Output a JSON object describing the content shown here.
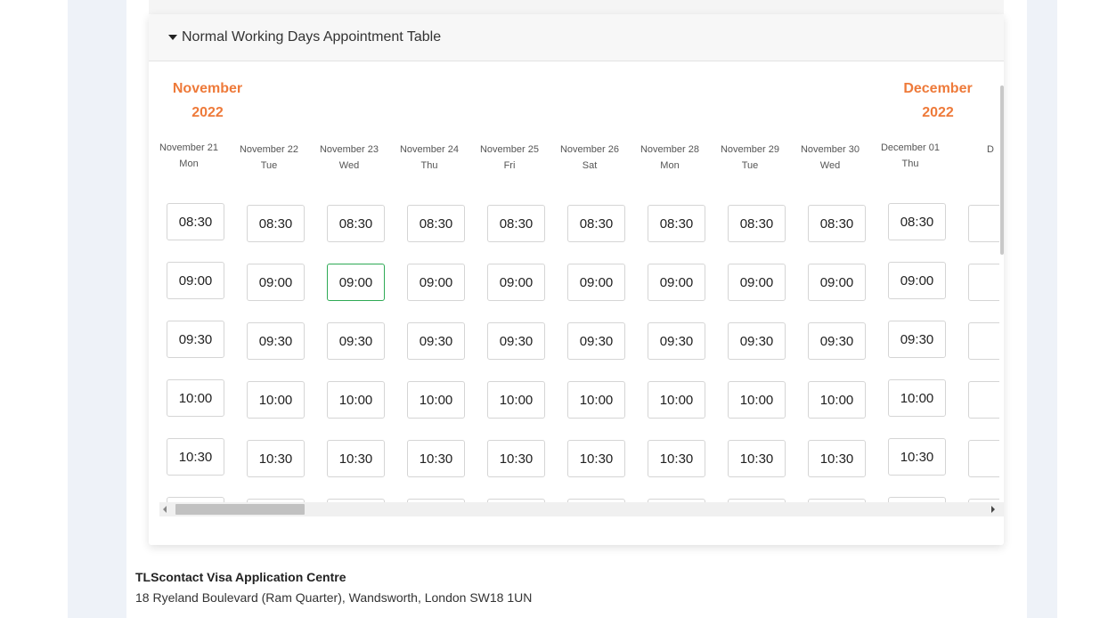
{
  "panel": {
    "title": "Normal Working Days Appointment Table"
  },
  "months": [
    {
      "name": "November",
      "year": "2022"
    },
    {
      "name": "December",
      "year": "2022"
    }
  ],
  "columns": [
    {
      "date": "November 21",
      "weekday": "Mon",
      "slots": [
        "08:30",
        "09:00",
        "09:30",
        "10:00",
        "10:30",
        ""
      ]
    },
    {
      "date": "November 22",
      "weekday": "Tue",
      "slots": [
        "08:30",
        "09:00",
        "09:30",
        "10:00",
        "10:30",
        ""
      ]
    },
    {
      "date": "November 23",
      "weekday": "Wed",
      "slots": [
        "08:30",
        "09:00",
        "09:30",
        "10:00",
        "10:30",
        ""
      ]
    },
    {
      "date": "November 24",
      "weekday": "Thu",
      "slots": [
        "08:30",
        "09:00",
        "09:30",
        "10:00",
        "10:30",
        ""
      ]
    },
    {
      "date": "November 25",
      "weekday": "Fri",
      "slots": [
        "08:30",
        "09:00",
        "09:30",
        "10:00",
        "10:30",
        ""
      ]
    },
    {
      "date": "November 26",
      "weekday": "Sat",
      "slots": [
        "08:30",
        "09:00",
        "09:30",
        "10:00",
        "10:30",
        ""
      ]
    },
    {
      "date": "November 28",
      "weekday": "Mon",
      "slots": [
        "08:30",
        "09:00",
        "09:30",
        "10:00",
        "10:30",
        ""
      ]
    },
    {
      "date": "November 29",
      "weekday": "Tue",
      "slots": [
        "08:30",
        "09:00",
        "09:30",
        "10:00",
        "10:30",
        ""
      ]
    },
    {
      "date": "November 30",
      "weekday": "Wed",
      "slots": [
        "08:30",
        "09:00",
        "09:30",
        "10:00",
        "10:30",
        ""
      ]
    },
    {
      "date": "December 01",
      "weekday": "Thu",
      "slots": [
        "08:30",
        "09:00",
        "09:30",
        "10:00",
        "10:30",
        ""
      ]
    },
    {
      "date": "D",
      "weekday": "",
      "slots": [
        "",
        "",
        "",
        "",
        "",
        ""
      ]
    }
  ],
  "selected_slot": {
    "date": "November 23",
    "time": "09:00"
  },
  "address": {
    "name": "TLScontact Visa Application Centre",
    "line": "18 Ryeland Boulevard (Ram Quarter), Wandsworth, London SW18 1UN"
  }
}
